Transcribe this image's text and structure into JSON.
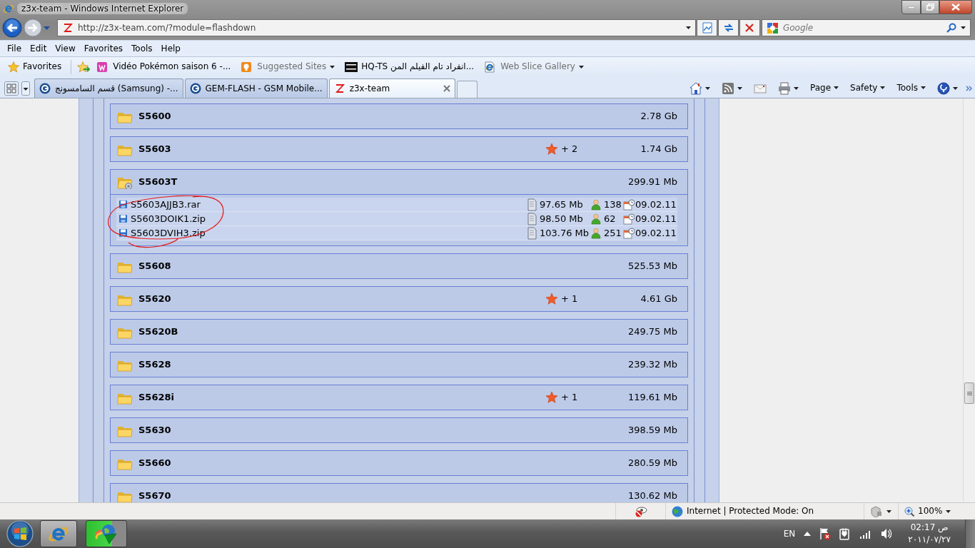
{
  "window": {
    "title": "z3x-team - Windows Internet Explorer"
  },
  "address_bar": {
    "url": "http://z3x-team.com/?module=flashdown"
  },
  "search": {
    "placeholder": "Google"
  },
  "menu": [
    "File",
    "Edit",
    "View",
    "Favorites",
    "Tools",
    "Help"
  ],
  "favorites_bar": {
    "label": "Favorites",
    "links": [
      {
        "label": "Vidéo Pokémon saison 6 -...",
        "greyed": false,
        "dropdown": false
      },
      {
        "label": "Suggested Sites",
        "greyed": true,
        "dropdown": true
      },
      {
        "label": "HQ-TS انفراد تام الفيلم المن...",
        "greyed": false,
        "dropdown": false
      },
      {
        "label": "Web Slice Gallery",
        "greyed": true,
        "dropdown": true
      }
    ]
  },
  "tabs": [
    {
      "title": "قسم السامسونج (Samsung) -...",
      "selected": false
    },
    {
      "title": "GEM-FLASH - GSM Mobile...",
      "selected": false
    },
    {
      "title": "z3x-team",
      "selected": true
    }
  ],
  "command_bar": [
    "Page",
    "Safety",
    "Tools"
  ],
  "folders": [
    {
      "name": "S5600",
      "size": "2.78 Gb",
      "expanded": false
    },
    {
      "name": "S5603",
      "rating": "+ 2",
      "size": "1.74 Gb",
      "expanded": false
    },
    {
      "name": "S5603T",
      "size": "299.91 Mb",
      "expanded": true,
      "files": [
        {
          "name": "S5603AJJB3.rar",
          "size": "97.65 Mb",
          "downloads": "138",
          "date": "09.02.11"
        },
        {
          "name": "S5603DOIK1.zip",
          "size": "98.50 Mb",
          "downloads": "62",
          "date": "09.02.11"
        },
        {
          "name": "S5603DVIH3.zip",
          "size": "103.76 Mb",
          "downloads": "251",
          "date": "09.02.11"
        }
      ]
    },
    {
      "name": "S5608",
      "size": "525.53 Mb",
      "expanded": false
    },
    {
      "name": "S5620",
      "rating": "+ 1",
      "size": "4.61 Gb",
      "expanded": false
    },
    {
      "name": "S5620B",
      "size": "249.75 Mb",
      "expanded": false
    },
    {
      "name": "S5628",
      "size": "239.32 Mb",
      "expanded": false
    },
    {
      "name": "S5628i",
      "rating": "+ 1",
      "size": "119.61 Mb",
      "expanded": false
    },
    {
      "name": "S5630",
      "size": "398.59 Mb",
      "expanded": false
    },
    {
      "name": "S5660",
      "size": "280.59 Mb",
      "expanded": false
    },
    {
      "name": "S5670",
      "size": "130.62 Mb",
      "expanded": false
    }
  ],
  "status_bar": {
    "zone": "Internet | Protected Mode: On",
    "zoom": "100%"
  },
  "taskbar": {
    "language": "EN",
    "time": "02:17 ص",
    "date": "٢٠١١/٠٧/٢٧"
  }
}
